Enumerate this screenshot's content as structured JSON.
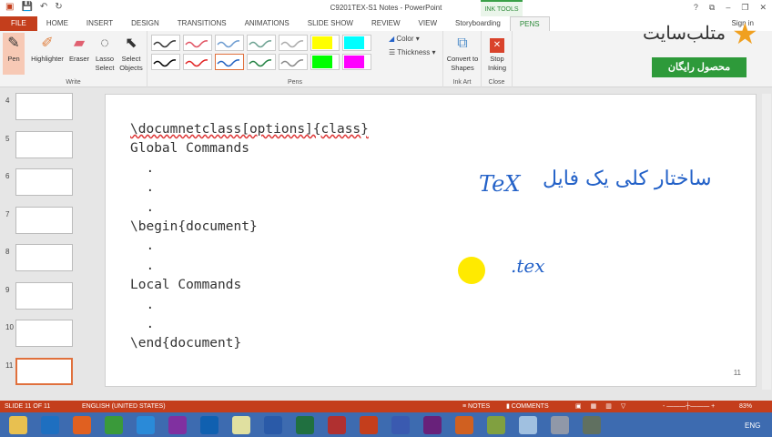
{
  "window": {
    "title": "C9201TEX-S1 Notes - PowerPoint",
    "context_tab": "INK TOOLS",
    "sign_in": "Sign in",
    "controls": [
      "?",
      "⧉",
      "–",
      "❐",
      "✕"
    ]
  },
  "tabs": [
    "FILE",
    "HOME",
    "INSERT",
    "DESIGN",
    "TRANSITIONS",
    "ANIMATIONS",
    "SLIDE SHOW",
    "REVIEW",
    "VIEW",
    "Storyboarding",
    "PENS"
  ],
  "ribbon": {
    "write": {
      "label": "Write",
      "buttons": [
        "Pen",
        "Highlighter",
        "Eraser",
        "Lasso Select",
        "Select Objects"
      ]
    },
    "pens": {
      "label": "Pens",
      "row1": [
        "#333333",
        "#e05060",
        "#6a9ad0",
        "#6aa090",
        "#aaaaaa",
        "#ffff00",
        "#00ffff"
      ],
      "row2": [
        "#000000",
        "#e02020",
        "#2060c0",
        "#208040",
        "#888888",
        "#00ff00",
        "#ff00ff"
      ],
      "color_label": "Color",
      "thickness_label": "Thickness"
    },
    "ink_art": {
      "label": "Ink Art",
      "button": "Convert to Shapes"
    },
    "close": {
      "label": "Close",
      "button": "Stop Inking"
    }
  },
  "branding": {
    "logo_text": "متلب‌سایت",
    "free_product": "محصول رایگان"
  },
  "slides": [
    4,
    5,
    6,
    7,
    8,
    9,
    10,
    11
  ],
  "selected_slide": 11,
  "slide": {
    "lines": [
      "\\documnetclass[options]{class}",
      "Global Commands",
      "  .",
      "  .",
      "  .",
      "\\begin{document}",
      "  .",
      "  .",
      "Local Commands",
      "  .",
      "  .",
      "\\end{document}"
    ],
    "ink_persian": "ساختار کلی یک فایل",
    "ink_tex": "TeX",
    "ink_ext": ".tex",
    "page_number": "11"
  },
  "status": {
    "slide": "SLIDE 11 OF 11",
    "language": "ENGLISH (UNITED STATES)",
    "notes": "NOTES",
    "comments": "COMMENTS",
    "zoom": "83%"
  },
  "taskbar": {
    "apps": [
      "Explorer",
      "OneDrive",
      "Firefox",
      "Chrome",
      "IE",
      "OneNote",
      "Outlook",
      "Pen",
      "Word",
      "Excel",
      "Access",
      "PowerPoint",
      "Visio",
      "Visual Studio",
      "MATLAB",
      "Notepad++",
      "Notepad",
      "Calculator",
      "Tool"
    ],
    "lang": "ENG"
  }
}
